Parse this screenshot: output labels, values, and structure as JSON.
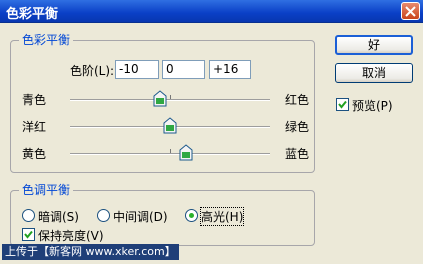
{
  "window": {
    "title": "色彩平衡"
  },
  "color_balance": {
    "legend": "色彩平衡",
    "levels_label": "色阶(L):",
    "levels": [
      "-10",
      "0",
      "+16"
    ],
    "sliders": [
      {
        "left": "青色",
        "right": "红色",
        "value": -10
      },
      {
        "left": "洋红",
        "right": "绿色",
        "value": 0
      },
      {
        "left": "黄色",
        "right": "蓝色",
        "value": 16
      }
    ]
  },
  "tone_balance": {
    "legend": "色调平衡",
    "options": [
      "暗调(S)",
      "中间调(D)",
      "高光(H)"
    ],
    "selected": "高光(H)",
    "preserve_luminosity": "保持亮度(V)"
  },
  "buttons": {
    "ok": "好",
    "cancel": "取消"
  },
  "preview": {
    "label": "预览(P)",
    "checked": true
  },
  "watermark": "上传于【新客网 www.xker.com】"
}
